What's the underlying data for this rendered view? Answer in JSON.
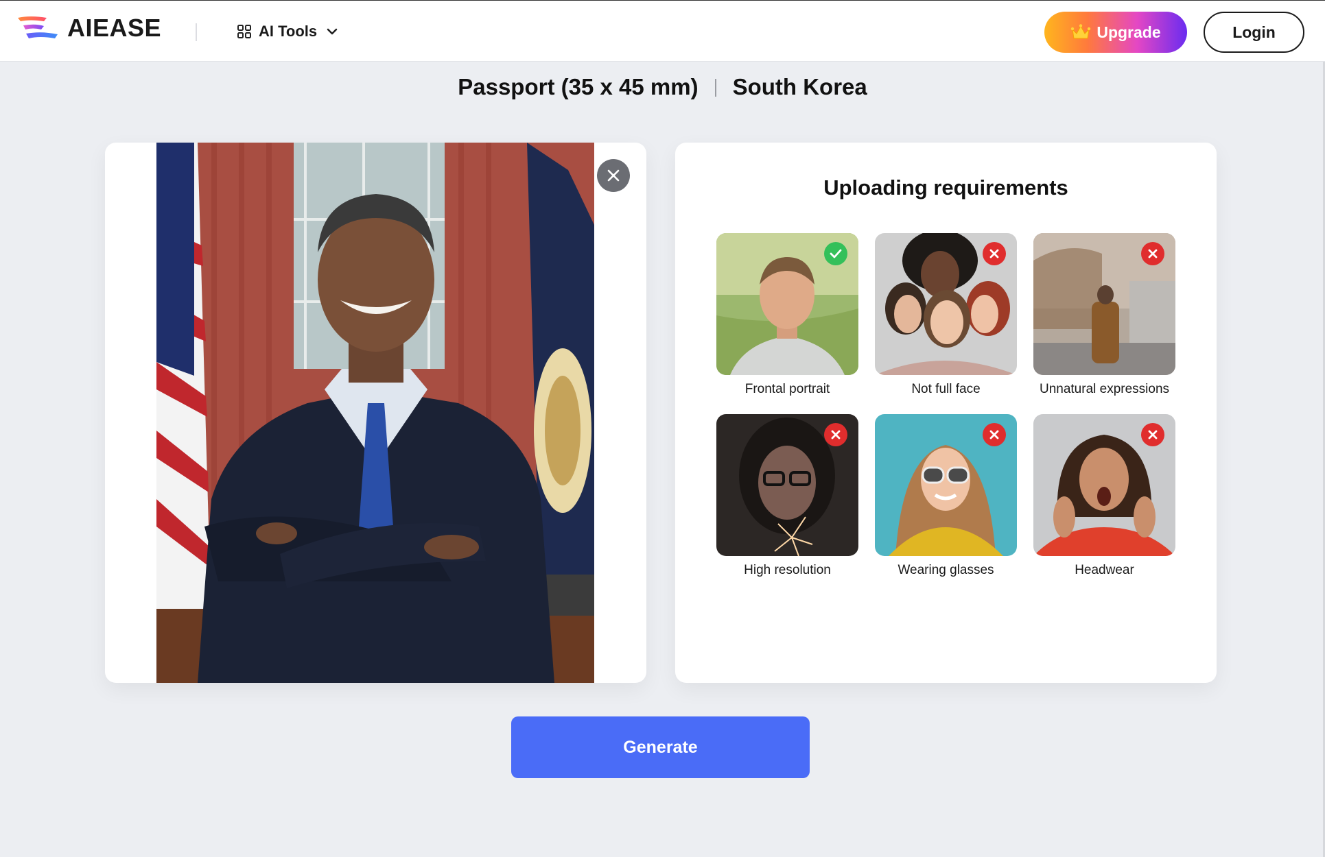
{
  "header": {
    "logo_text": "AIEASE",
    "ai_tools_label": "AI Tools",
    "upgrade_label": "Upgrade",
    "login_label": "Login"
  },
  "title": {
    "spec": "Passport (35 x 45 mm)",
    "country": "South Korea"
  },
  "requirements": {
    "title": "Uploading requirements",
    "items": [
      {
        "label": "Frontal portrait",
        "status": "allowed"
      },
      {
        "label": "Not full face",
        "status": "rejected"
      },
      {
        "label": "Unnatural expressions",
        "status": "rejected"
      },
      {
        "label": "High resolution",
        "status": "rejected"
      },
      {
        "label": "Wearing glasses",
        "status": "rejected"
      },
      {
        "label": "Headwear",
        "status": "rejected"
      }
    ]
  },
  "actions": {
    "generate_label": "Generate"
  },
  "colors": {
    "accent": "#4a6cf7",
    "ok": "#34c05a",
    "bad": "#e02d2d",
    "background": "#eceef2"
  }
}
